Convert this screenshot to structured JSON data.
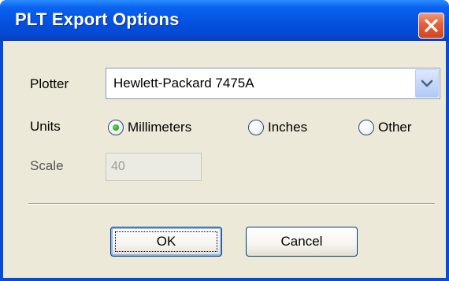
{
  "window": {
    "title": "PLT Export Options",
    "close_icon": "close-x-icon"
  },
  "form": {
    "plotter": {
      "label": "Plotter",
      "selected": "Hewlett-Packard 7475A",
      "dropdown_icon": "chevron-down-icon"
    },
    "units": {
      "label": "Units",
      "options": [
        {
          "label": "Millimeters",
          "selected": true
        },
        {
          "label": "Inches",
          "selected": false
        },
        {
          "label": "Other",
          "selected": false
        }
      ]
    },
    "scale": {
      "label": "Scale",
      "value": "40",
      "enabled": false
    }
  },
  "buttons": {
    "ok": "OK",
    "cancel": "Cancel"
  },
  "colors": {
    "titlebar": "#0551e0",
    "face": "#ece9d8",
    "close": "#d2451f",
    "radio_selected": "#21a121"
  }
}
